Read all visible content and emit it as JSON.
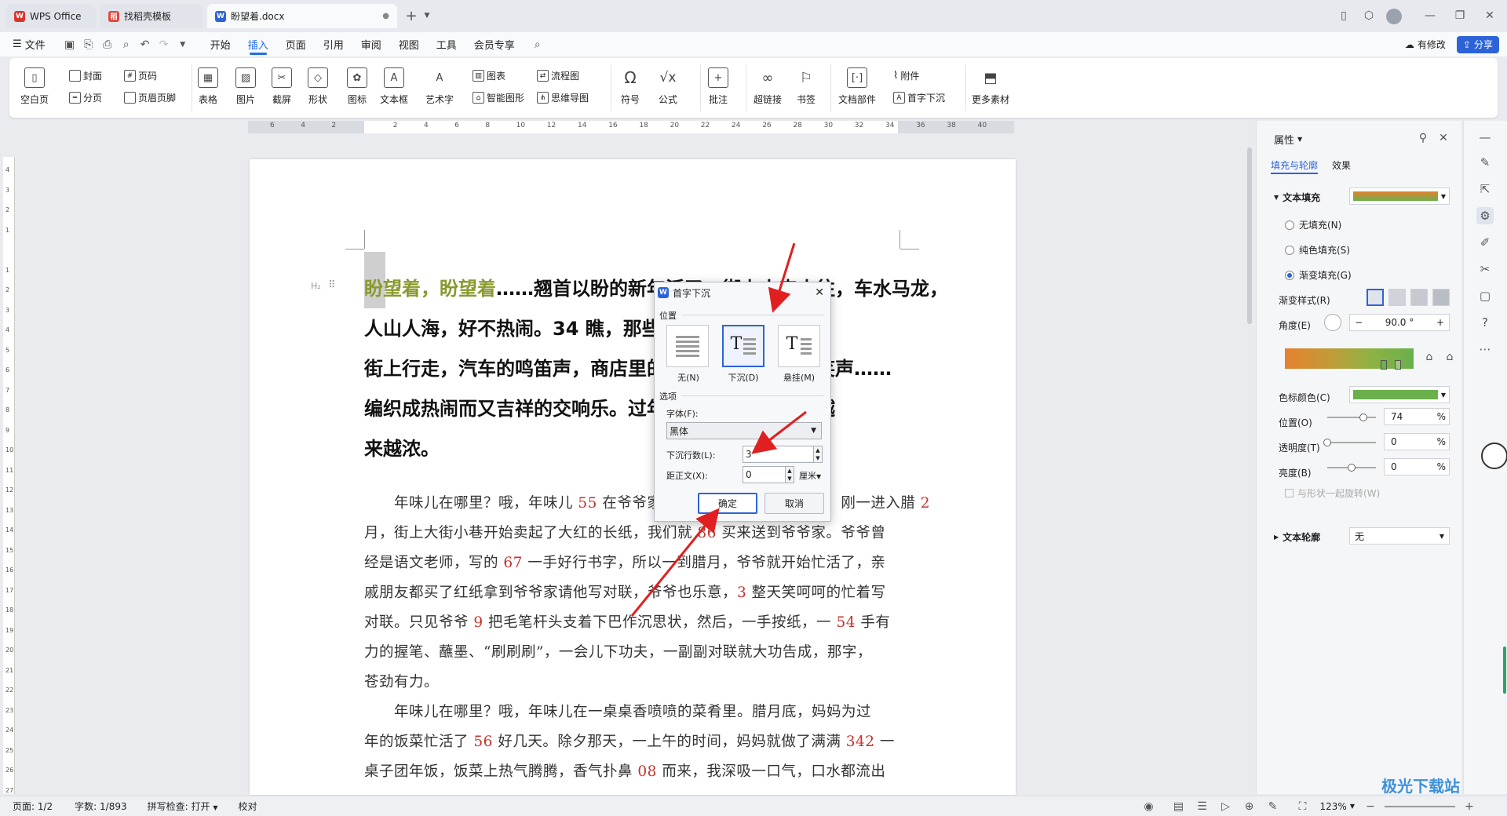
{
  "tabs": [
    {
      "label": "WPS Office",
      "badge": "W",
      "color": "#d9342b"
    },
    {
      "label": "找稻壳模板",
      "badge": "稻",
      "color": "#e2483d"
    },
    {
      "label": "盼望着.docx",
      "badge": "W",
      "color": "#2d63d8"
    }
  ],
  "menu": {
    "file": "文件",
    "items": [
      "开始",
      "插入",
      "页面",
      "引用",
      "审阅",
      "视图",
      "工具",
      "会员专享"
    ],
    "active": "插入",
    "modified": "有修改",
    "share": "分享"
  },
  "ribbon": {
    "blank_page": "空白页",
    "cover": "封面",
    "page_break": "分页",
    "page_num": "页码",
    "header_footer": "页眉页脚",
    "table": "表格",
    "picture": "图片",
    "screenshot": "截屏",
    "shape": "形状",
    "icon": "图标",
    "textbox": "文本框",
    "art_text": "艺术字",
    "chart": "图表",
    "smart_art": "智能图形",
    "flowchart": "流程图",
    "mindmap": "思维导图",
    "symbol": "符号",
    "formula": "公式",
    "comment": "批注",
    "hyperlink": "超链接",
    "bookmark": "书签",
    "doc_parts": "文档部件",
    "attachment": "附件",
    "drop_cap": "首字下沉",
    "more": "更多素材"
  },
  "ruler": {
    "h_ticks": [
      "6",
      "4",
      "2",
      "",
      "2",
      "4",
      "6",
      "8",
      "10",
      "12",
      "14",
      "16",
      "18",
      "20",
      "22",
      "24",
      "26",
      "28",
      "30",
      "32",
      "34",
      "36",
      "38",
      "40"
    ],
    "v_ticks": [
      "4",
      "3",
      "2",
      "1",
      "",
      "1",
      "2",
      "3",
      "4",
      "5",
      "6",
      "7",
      "8",
      "9",
      "10",
      "11",
      "12",
      "13",
      "14",
      "15",
      "16",
      "17",
      "18",
      "19",
      "20",
      "21",
      "22",
      "23",
      "24",
      "25",
      "26",
      "27"
    ]
  },
  "document": {
    "heading_marker": "H₂",
    "heading_colored": "盼望着，盼望着",
    "heading_rest": "……翘首以盼的新年活了，街上人来人往，车水马龙，人山人海，好不热闹。34 瞧，那些穿着新衣服的人在街上行走，汽车的鸣笛声，商店里的音乐声，人们的欢笑声……编织成热闹而又吉祥的交响乐。过年了，浓浓的年味儿越来越浓。",
    "heading_lines": [
      [
        "盼望着，盼望着",
        "……翘首以盼的新年活了，街上人来人往，车水马龙，"
      ],
      [
        "",
        "人山人海，好不热闹。34 瞧，那些穿着新衣服的人在"
      ],
      [
        "",
        "街上行走，汽车的鸣笛声，商店里的音乐声，人们的欢笑声……"
      ],
      [
        "",
        "编织成热闹而又吉祥的交响乐。过年了，浓浓的年味儿越"
      ],
      [
        "",
        "来越浓。"
      ]
    ],
    "para1": [
      [
        "　　年味儿在哪里？哦，年味儿 ",
        "55",
        " 在爷爷家的春联里。每年进入腊月，刚一进入腊 ",
        "2"
      ],
      [
        "月，街上大街小巷开始卖起了大红的长纸，我们就 ",
        "86",
        " 买来送到爷爷家。爷爷曾",
        ""
      ],
      [
        "经是语文老师，写的 ",
        "67",
        " 一手好行书字，所以一到腊月，爷爷就开始忙活了，亲",
        ""
      ],
      [
        "戚朋友都买了红纸拿到爷爷家请他写对联，爷爷也乐意，",
        "3",
        " 整天笑呵呵的忙着写",
        ""
      ],
      [
        "对联。只见爷爷 ",
        "9",
        " 把毛笔杆头支着下巴作沉思状，然后，一手按纸，一 ",
        "54"
      ],
      [
        "力的握笔、蘸墨、“刷刷刷”，一会儿下功夫，一副副对联就大功告成，那字，",
        "",
        "",
        ""
      ],
      [
        "苍劲有力。",
        "",
        "",
        ""
      ]
    ],
    "para1_tail": " 手有",
    "para2": [
      [
        "　　年味儿在哪里？哦，年味儿在一桌桌香喷喷的菜肴里。腊月底，妈妈为过",
        "",
        ""
      ],
      [
        "年的饭菜忙活了 ",
        "56",
        " 好几天。除夕那天，一上午的时间，妈妈就做了满满 "
      ],
      [
        "桌子团年饭，饭菜上热气腾腾，香气扑鼻 ",
        "08",
        " 而来，我深吸一口气，口水都流出"
      ]
    ],
    "para2_num": "342",
    "para2_tail": " 一"
  },
  "dialog": {
    "title": "首字下沉",
    "position_label": "位置",
    "opt_none": "无(N)",
    "opt_drop": "下沉(D)",
    "opt_margin": "悬挂(M)",
    "options_label": "选项",
    "font_label": "字体(F):",
    "font_value": "黑体",
    "lines_label": "下沉行数(L):",
    "lines_value": "3",
    "distance_label": "距正文(X):",
    "distance_value": "0",
    "unit": "厘米",
    "ok": "确定",
    "cancel": "取消"
  },
  "panel": {
    "title": "属性",
    "tab_fill": "填充与轮廓",
    "tab_effect": "效果",
    "text_fill": "文本填充",
    "no_fill": "无填充(N)",
    "solid_fill": "纯色填充(S)",
    "gradient_fill": "渐变填充(G)",
    "gradient_style": "渐变样式(R)",
    "angle": "角度(E)",
    "angle_value": "90.0 °",
    "stop_color": "色标颜色(C)",
    "position": "位置(O)",
    "position_value": "74",
    "transparency": "透明度(T)",
    "transparency_value": "0",
    "brightness": "亮度(B)",
    "brightness_value": "0",
    "pct": "%",
    "rotate_with_shape": "与形状一起旋转(W)",
    "text_outline": "文本轮廓",
    "outline_value": "无",
    "accent": "#2d63d8",
    "green": "#6ab04c",
    "orange": "#e5812e",
    "sliders": {
      "position": 0.74,
      "transparency": 0.0,
      "brightness": 0.5
    }
  },
  "status": {
    "page": "页面: 1/2",
    "words": "字数: 1/893",
    "spell": "拼写检查: 打开",
    "proof": "校对",
    "zoom": "123%"
  },
  "watermark": "极光下载站"
}
